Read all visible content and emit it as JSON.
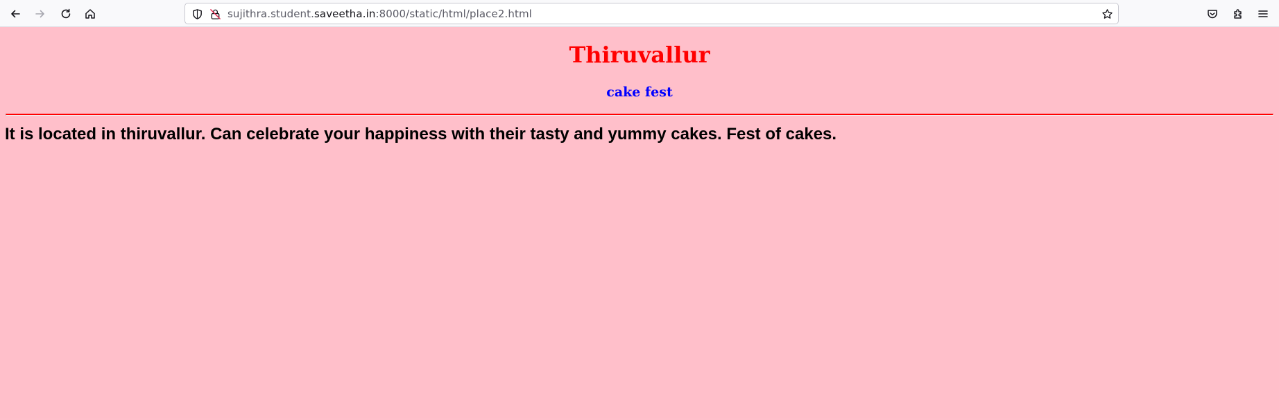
{
  "browser": {
    "url_prefix": "sujithra.student.",
    "url_domain": "saveetha.in",
    "url_suffix": ":8000/static/html/place2.html",
    "icons": {
      "back": "arrow-left-icon",
      "forward": "arrow-right-icon",
      "reload": "reload-icon",
      "home": "home-icon",
      "tracking": "shield-icon",
      "security": "lock-icon",
      "bookmark": "star-icon",
      "pocket": "pocket-icon",
      "extensions": "puzzle-icon",
      "menu": "hamburger-menu-icon"
    }
  },
  "page": {
    "title": "Thiruvallur",
    "subtitle": "cake fest",
    "description": "It is located in thiruvallur. Can celebrate your happiness with their tasty and yummy cakes. Fest of cakes.",
    "colors": {
      "background": "#ffbfca",
      "title": "#ff0000",
      "subtitle": "#0000ff",
      "divider": "#ff0000",
      "text": "#000000"
    }
  }
}
